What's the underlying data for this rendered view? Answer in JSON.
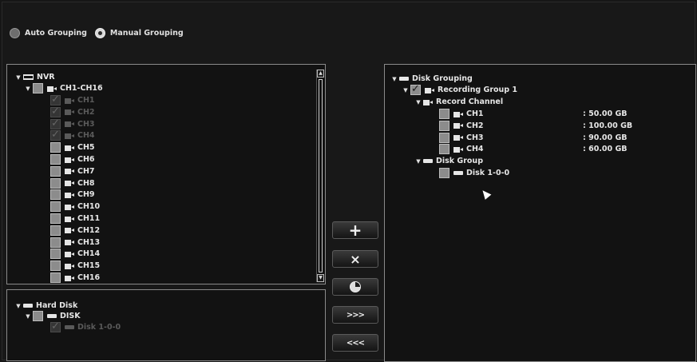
{
  "grouping_mode": {
    "options": [
      {
        "label": "Auto Grouping",
        "selected": false
      },
      {
        "label": "Manual Grouping",
        "selected": true
      }
    ]
  },
  "nvr_tree": {
    "root": "NVR",
    "group": "CH1-CH16",
    "channels": [
      {
        "label": "CH1",
        "checked": true,
        "disabled": true
      },
      {
        "label": "CH2",
        "checked": true,
        "disabled": true
      },
      {
        "label": "CH3",
        "checked": true,
        "disabled": true
      },
      {
        "label": "CH4",
        "checked": true,
        "disabled": true
      },
      {
        "label": "CH5",
        "checked": false,
        "disabled": false
      },
      {
        "label": "CH6",
        "checked": false,
        "disabled": false
      },
      {
        "label": "CH7",
        "checked": false,
        "disabled": false
      },
      {
        "label": "CH8",
        "checked": false,
        "disabled": false
      },
      {
        "label": "CH9",
        "checked": false,
        "disabled": false
      },
      {
        "label": "CH10",
        "checked": false,
        "disabled": false
      },
      {
        "label": "CH11",
        "checked": false,
        "disabled": false
      },
      {
        "label": "CH12",
        "checked": false,
        "disabled": false
      },
      {
        "label": "CH13",
        "checked": false,
        "disabled": false
      },
      {
        "label": "CH14",
        "checked": false,
        "disabled": false
      },
      {
        "label": "CH15",
        "checked": false,
        "disabled": false
      },
      {
        "label": "CH16",
        "checked": false,
        "disabled": false
      }
    ]
  },
  "hard_disk_tree": {
    "root": "Hard Disk",
    "group": "DISK",
    "disks": [
      {
        "label": "Disk 1-0-0",
        "checked": true,
        "disabled": true
      }
    ]
  },
  "buttons": {
    "add": "+",
    "remove": "×",
    "move_right": ">>>",
    "move_left": "<<<"
  },
  "disk_grouping_tree": {
    "root": "Disk Grouping",
    "recording_group": "Recording Group 1",
    "record_channel_label": "Record Channel",
    "channels": [
      {
        "label": "CH1",
        "size": ": 50.00 GB"
      },
      {
        "label": "CH2",
        "size": ": 100.00 GB"
      },
      {
        "label": "CH3",
        "size": ": 90.00 GB"
      },
      {
        "label": "CH4",
        "size": ": 60.00 GB"
      }
    ],
    "disk_group_label": "Disk Group",
    "disks": [
      {
        "label": "Disk 1-0-0"
      }
    ]
  }
}
